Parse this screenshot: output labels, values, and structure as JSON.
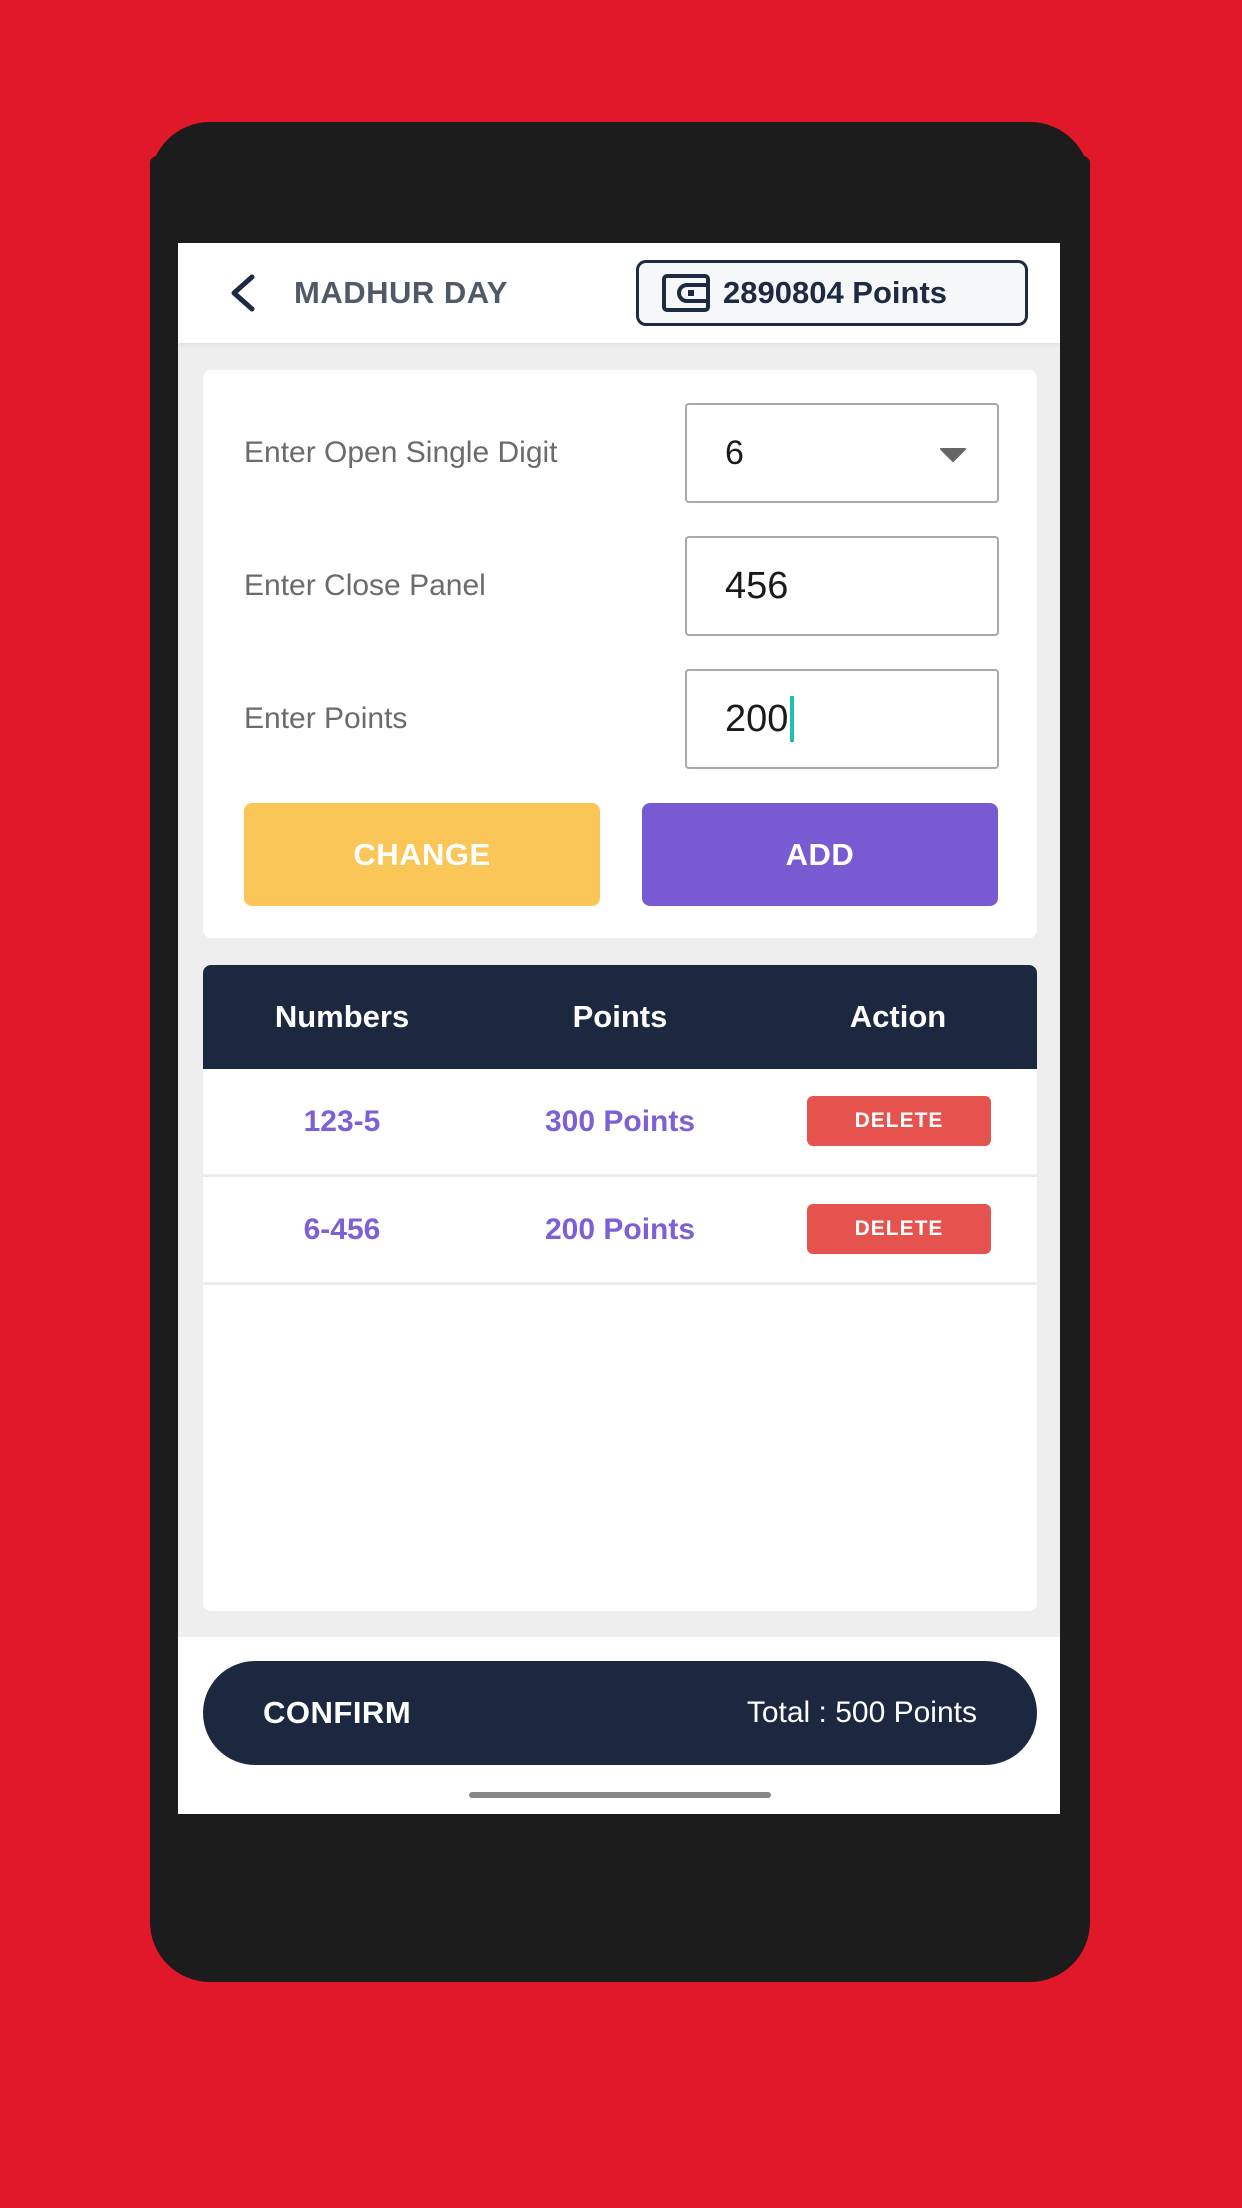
{
  "header": {
    "title": "MADHUR DAY",
    "wallet_points": "2890804 Points"
  },
  "form": {
    "open_digit_label": "Enter Open Single Digit",
    "open_digit_value": "6",
    "close_panel_label": "Enter Close Panel",
    "close_panel_value": "456",
    "points_label": "Enter Points",
    "points_value": "200",
    "change_label": "CHANGE",
    "add_label": "ADD"
  },
  "table": {
    "headers": [
      "Numbers",
      "Points",
      "Action"
    ],
    "rows": [
      {
        "number": "123-5",
        "points": "300 Points",
        "action": "DELETE"
      },
      {
        "number": "6-456",
        "points": "200 Points",
        "action": "DELETE"
      }
    ]
  },
  "footer": {
    "confirm_label": "CONFIRM",
    "total_label": "Total : 500 Points"
  },
  "colors": {
    "background": "#e01829",
    "navy": "#1c2740",
    "change_button": "#f9c657",
    "add_button": "#785bd3",
    "delete_button": "#e6534f",
    "row_text": "#7d5fd6"
  },
  "icons": {
    "back": "chevron-left-icon",
    "wallet": "wallet-icon",
    "dropdown": "caret-down-icon"
  }
}
